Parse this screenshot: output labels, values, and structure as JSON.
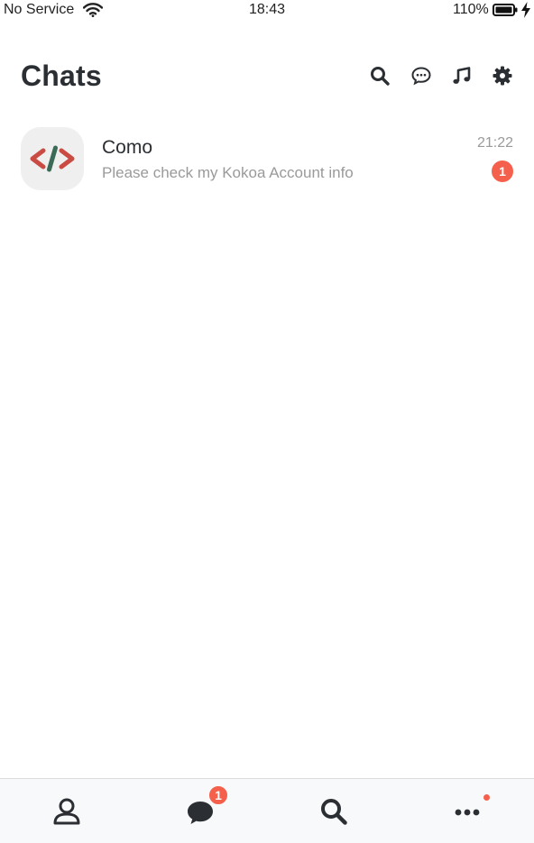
{
  "status_bar": {
    "carrier": "No Service",
    "time": "18:43",
    "battery_percent": "110%",
    "wifi_icon": "wifi-icon",
    "battery_icon": "battery-icon",
    "charging_icon": "lightning-bolt-icon"
  },
  "header": {
    "title": "Chats",
    "actions": [
      {
        "icon": "search-icon"
      },
      {
        "icon": "new-chat-icon"
      },
      {
        "icon": "music-note-icon"
      },
      {
        "icon": "gear-icon"
      }
    ]
  },
  "chats": [
    {
      "name": "Como",
      "preview": "Please check my Kokoa Account info",
      "time": "21:22",
      "unread": "1",
      "avatar_icon": "code-brackets-icon"
    }
  ],
  "tab_bar": {
    "tabs": [
      {
        "icon": "person-icon",
        "badge": ""
      },
      {
        "icon": "chat-bubble-icon",
        "badge": "1"
      },
      {
        "icon": "search-icon",
        "badge": ""
      },
      {
        "icon": "more-dots-icon",
        "dot": true
      }
    ]
  },
  "colors": {
    "accent": "#f4604b",
    "text_primary": "#2b2f33",
    "text_secondary": "#9a9a9a",
    "tab_bar_bg": "#f8f9fa"
  }
}
